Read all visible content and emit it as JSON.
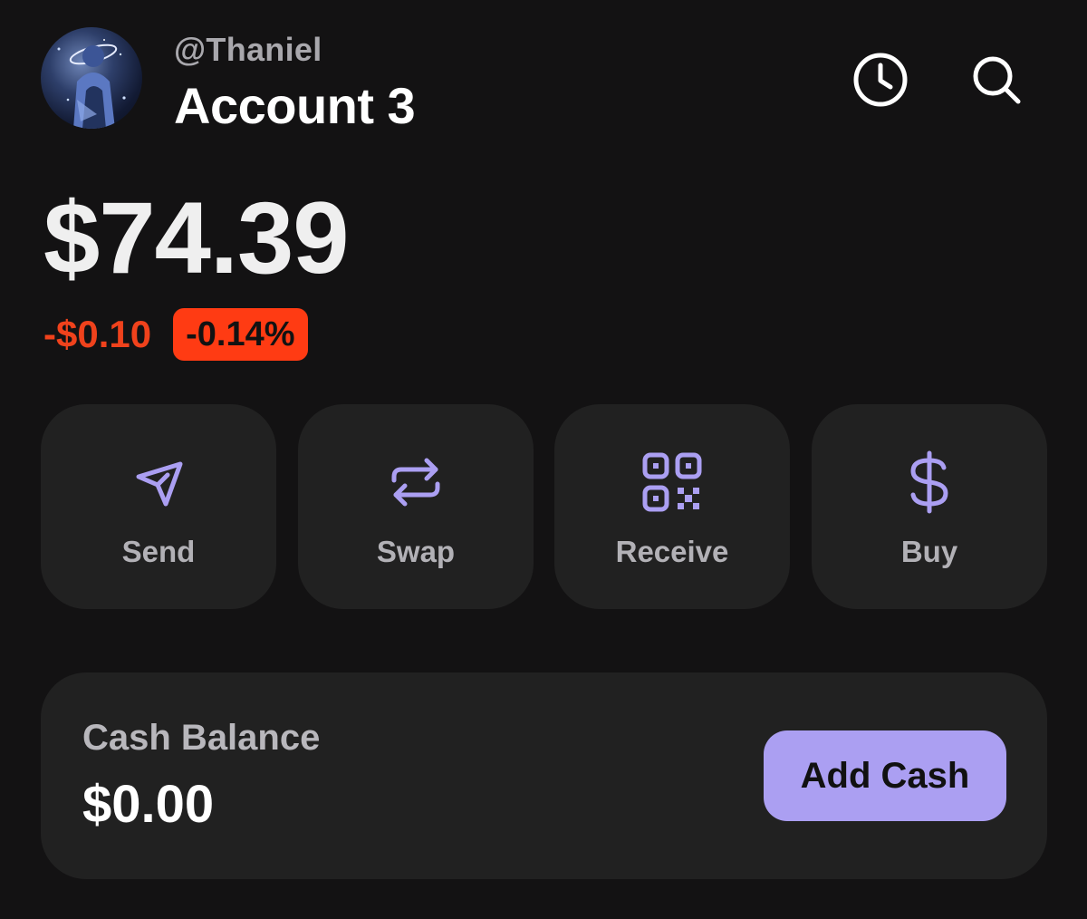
{
  "header": {
    "handle": "@Thaniel",
    "account_name": "Account 3",
    "icons": [
      "history-icon",
      "search-icon"
    ]
  },
  "portfolio": {
    "balance": "$74.39",
    "change_value": "-$0.10",
    "change_percent": "-0.14%"
  },
  "actions": [
    {
      "label": "Send",
      "icon": "send-icon"
    },
    {
      "label": "Swap",
      "icon": "swap-icon"
    },
    {
      "label": "Receive",
      "icon": "qr-code-icon"
    },
    {
      "label": "Buy",
      "icon": "dollar-icon"
    }
  ],
  "cash": {
    "label": "Cash Balance",
    "value": "$0.00",
    "button_label": "Add Cash"
  },
  "colors": {
    "background": "#131213",
    "card": "#212121",
    "accent": "#ab9ff2",
    "negative": "#f0421c"
  }
}
